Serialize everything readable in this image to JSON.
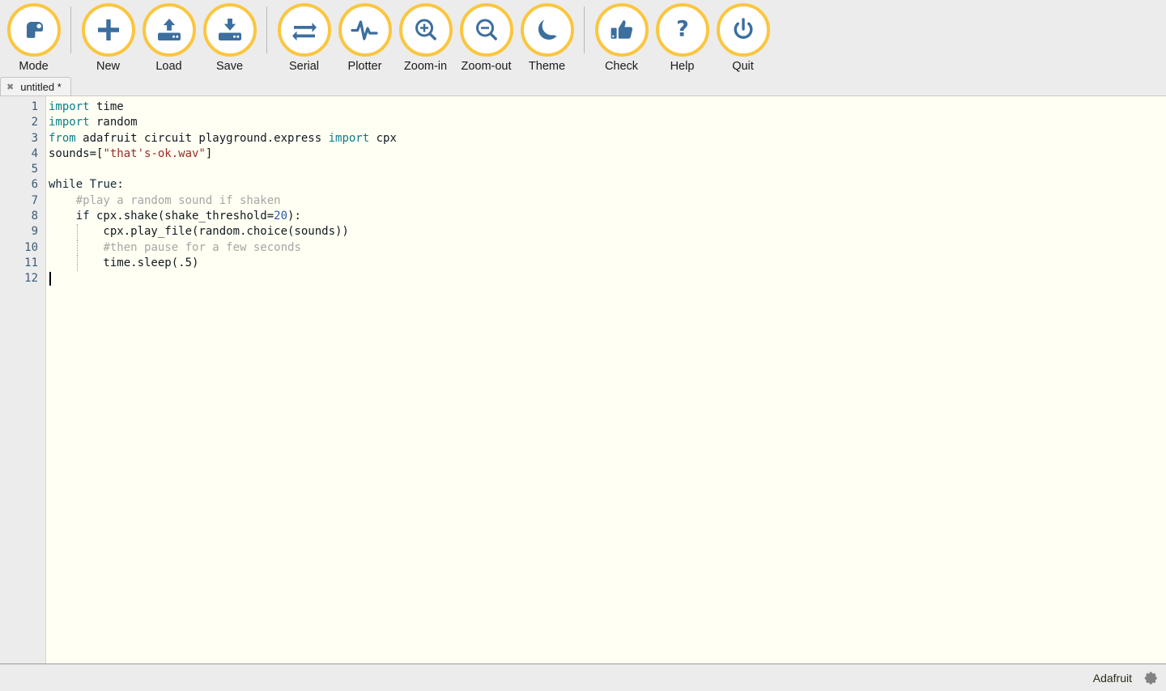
{
  "window": {
    "app_name": "Mu Editor",
    "accent_yellow": "#fbc63f",
    "icon_blue": "#3c6e9e",
    "toolbar_bg": "#ececec",
    "editor_bg": "#fffff3"
  },
  "toolbar": {
    "items": [
      {
        "label": "Mode",
        "icon": "mode-snake-icon",
        "group": 0
      },
      {
        "label": "New",
        "icon": "plus-icon",
        "group": 1
      },
      {
        "label": "Load",
        "icon": "upload-drive-icon",
        "group": 1
      },
      {
        "label": "Save",
        "icon": "save-drive-icon",
        "group": 1
      },
      {
        "label": "Serial",
        "icon": "exchange-arrows-icon",
        "group": 2
      },
      {
        "label": "Plotter",
        "icon": "pulse-wave-icon",
        "group": 2
      },
      {
        "label": "Zoom-in",
        "icon": "magnifier-plus-icon",
        "group": 2
      },
      {
        "label": "Zoom-out",
        "icon": "magnifier-minus-icon",
        "group": 2
      },
      {
        "label": "Theme",
        "icon": "moon-icon",
        "group": 2
      },
      {
        "label": "Check",
        "icon": "thumbs-up-icon",
        "group": 3
      },
      {
        "label": "Help",
        "icon": "question-mark-icon",
        "group": 3
      },
      {
        "label": "Quit",
        "icon": "power-icon",
        "group": 3
      }
    ]
  },
  "tabs": [
    {
      "title": "untitled *",
      "close_glyph": "✖",
      "active": true
    }
  ],
  "editor": {
    "line_numbers": [
      "1",
      "2",
      "3",
      "4",
      "5",
      "6",
      "7",
      "8",
      "9",
      "10",
      "11",
      "12"
    ],
    "cursor_line": 12,
    "cursor_column": 1,
    "lines": [
      {
        "n": 1,
        "text": "import time",
        "tokens": [
          {
            "t": "import",
            "c": "kw"
          },
          {
            "t": " time",
            "c": "plain"
          }
        ]
      },
      {
        "n": 2,
        "text": "import random",
        "tokens": [
          {
            "t": "import",
            "c": "kw"
          },
          {
            "t": " random",
            "c": "plain"
          }
        ]
      },
      {
        "n": 3,
        "text": "from adafruit circuit playground.express import cpx",
        "tokens": [
          {
            "t": "from",
            "c": "kw"
          },
          {
            "t": " adafruit circuit playground.express ",
            "c": "plain"
          },
          {
            "t": "import",
            "c": "kw"
          },
          {
            "t": " cpx",
            "c": "plain"
          }
        ]
      },
      {
        "n": 4,
        "text": "sounds=[\"that's-ok.wav\"]",
        "tokens": [
          {
            "t": "sounds=[",
            "c": "plain"
          },
          {
            "t": "\"that's-ok.wav\"",
            "c": "str"
          },
          {
            "t": "]",
            "c": "plain"
          }
        ]
      },
      {
        "n": 5,
        "text": "",
        "tokens": []
      },
      {
        "n": 6,
        "text": "while True:",
        "tokens": [
          {
            "t": "while",
            "c": "kw2"
          },
          {
            "t": " ",
            "c": "plain"
          },
          {
            "t": "True",
            "c": "kw2"
          },
          {
            "t": ":",
            "c": "plain"
          }
        ]
      },
      {
        "n": 7,
        "text": "    #play a random sound if shaken",
        "tokens": [
          {
            "t": "    ",
            "c": "plain"
          },
          {
            "t": "#play a random sound if shaken",
            "c": "com"
          }
        ]
      },
      {
        "n": 8,
        "text": "    if cpx.shake(shake_threshold=20):",
        "tokens": [
          {
            "t": "    ",
            "c": "plain"
          },
          {
            "t": "if",
            "c": "kw2"
          },
          {
            "t": " cpx.shake(shake_threshold=",
            "c": "plain"
          },
          {
            "t": "20",
            "c": "num"
          },
          {
            "t": "):",
            "c": "plain"
          }
        ]
      },
      {
        "n": 9,
        "text": "        cpx.play_file(random.choice(sounds))",
        "tokens": [
          {
            "t": "        cpx.play_file(random.choice(sounds))",
            "c": "plain"
          }
        ]
      },
      {
        "n": 10,
        "text": "        #then pause for a few seconds",
        "tokens": [
          {
            "t": "        ",
            "c": "plain"
          },
          {
            "t": "#then pause for a few seconds",
            "c": "com"
          }
        ]
      },
      {
        "n": 11,
        "text": "        time.sleep(.5)",
        "tokens": [
          {
            "t": "        time.sleep(.5)",
            "c": "plain"
          }
        ]
      },
      {
        "n": 12,
        "text": "",
        "tokens": []
      }
    ]
  },
  "statusbar": {
    "mode_label": "Adafruit",
    "gear_icon": "gear-icon"
  }
}
